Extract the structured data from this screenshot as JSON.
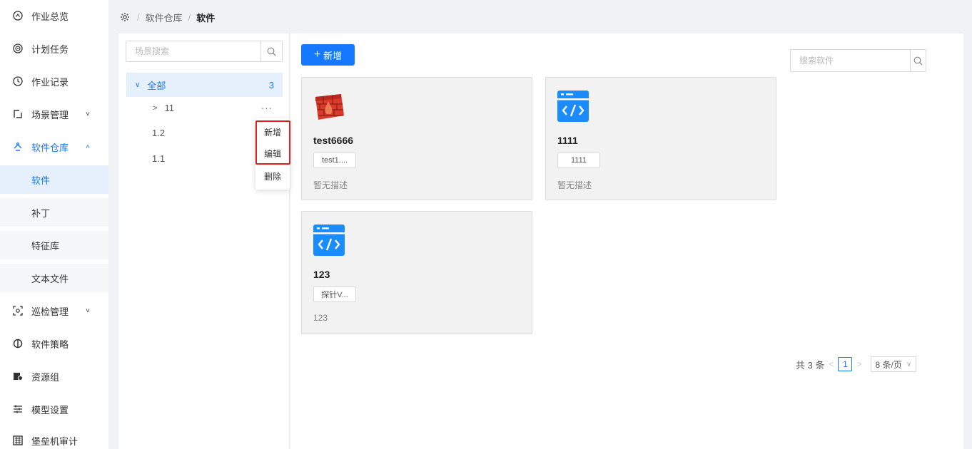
{
  "sidebar": {
    "items": [
      {
        "label": "作业总览",
        "icon": "dashboard-icon"
      },
      {
        "label": "计划任务",
        "icon": "target-icon"
      },
      {
        "label": "作业记录",
        "icon": "history-icon"
      },
      {
        "label": "场景管理",
        "icon": "scene-icon"
      },
      {
        "label": "软件仓库",
        "icon": "repository-icon"
      },
      {
        "label": "巡检管理",
        "icon": "inspect-icon"
      },
      {
        "label": "软件策略",
        "icon": "policy-icon"
      },
      {
        "label": "资源组",
        "icon": "resource-icon"
      },
      {
        "label": "模型设置",
        "icon": "settings-icon"
      },
      {
        "label": "堡垒机审计",
        "icon": "audit-icon"
      }
    ],
    "subitems": [
      {
        "label": "软件"
      },
      {
        "label": "补丁"
      },
      {
        "label": "特征库"
      },
      {
        "label": "文本文件"
      }
    ]
  },
  "breadcrumb": {
    "parent": "软件仓库",
    "current": "软件",
    "sep": "/"
  },
  "tree": {
    "search_placeholder": "场景搜索",
    "root_label": "全部",
    "root_count": "3",
    "nodes": [
      {
        "label": "11"
      },
      {
        "label": "1.2"
      },
      {
        "label": "1.1"
      }
    ],
    "more": "···"
  },
  "context_menu": {
    "items": [
      {
        "label": "新增"
      },
      {
        "label": "编辑"
      },
      {
        "label": "删除"
      }
    ]
  },
  "main": {
    "add_label": "新增",
    "search_placeholder": "搜索软件",
    "cards": [
      {
        "name": "test6666",
        "tag": "test1....",
        "desc": "暂无描述",
        "icon": "firewall-icon"
      },
      {
        "name": "1111",
        "tag": "1111",
        "desc": "暂无描述",
        "icon": "code-window-icon"
      },
      {
        "name": "123",
        "tag": "探针V...",
        "desc": "123",
        "icon": "code-window-icon"
      }
    ],
    "pager": {
      "total": "共 3 条",
      "page": "1",
      "size": "8 条/页"
    }
  },
  "colors": {
    "accent": "#1677ff",
    "highlight": "#e02020"
  }
}
